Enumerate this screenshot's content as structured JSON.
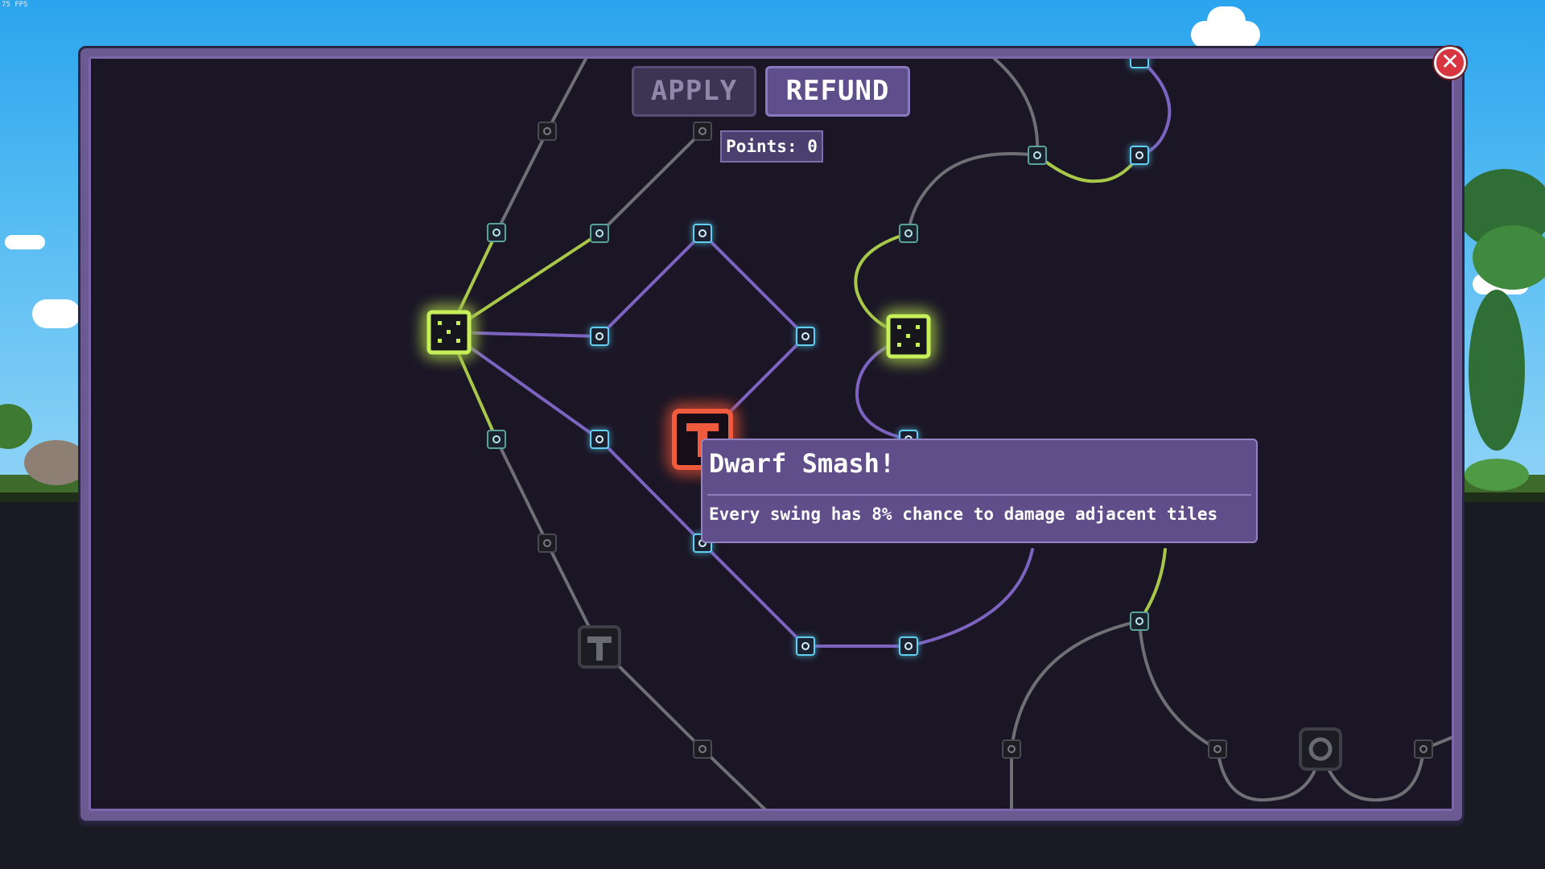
{
  "fps_label": "75 FPS",
  "toolbar": {
    "apply_label": "APPLY",
    "refund_label": "REFUND"
  },
  "points": {
    "label": "Points: 0"
  },
  "tooltip": {
    "title": "Dwarf Smash!",
    "description": "Every swing has 8% chance to damage adjacent tiles"
  },
  "icons": {
    "close": "close-icon",
    "small_node_person": "person-rune-icon",
    "small_node_sword": "sword-rune-icon",
    "hub_node": "dice-icon",
    "hammer_node": "hammer-icon",
    "gear_node": "gear-icon"
  },
  "colors": {
    "active_green": "#b5e24a",
    "unlocked_blue": "#5fd0f2",
    "highlight_red": "#f05a3c",
    "path_purple": "#7c63c0",
    "path_gray": "#6f6f76",
    "panel_purple": "#6b5a92"
  }
}
